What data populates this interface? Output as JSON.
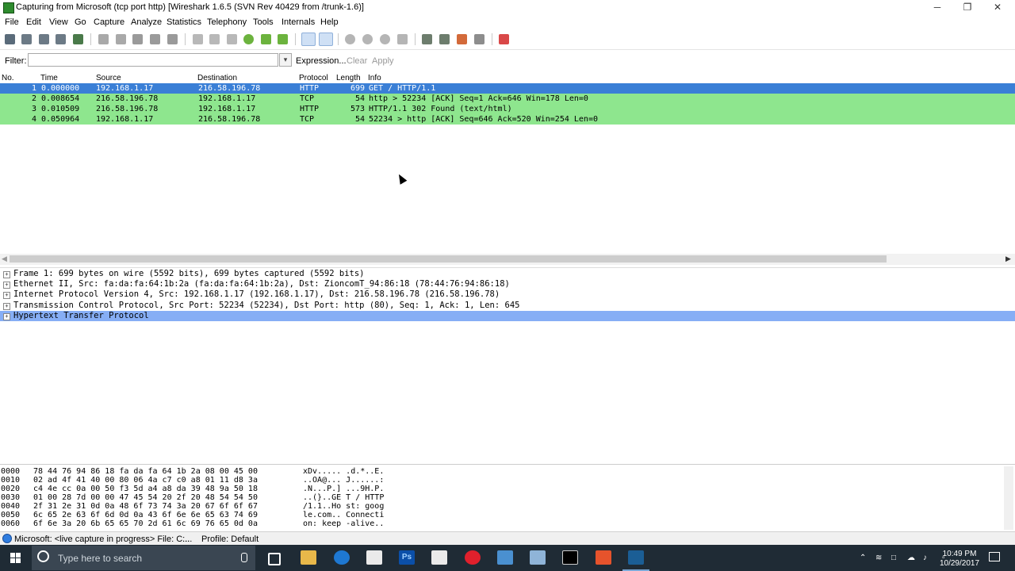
{
  "window": {
    "title": "Capturing from Microsoft (tcp port http)   [Wireshark 1.6.5  (SVN Rev 40429 from /trunk-1.6)]",
    "minimize": "─",
    "maximize": "❐",
    "close": "✕"
  },
  "menu": [
    "File",
    "Edit",
    "View",
    "Go",
    "Capture",
    "Analyze",
    "Statistics",
    "Telephony",
    "Tools",
    "Internals",
    "Help"
  ],
  "filter": {
    "label": "Filter:",
    "value": "",
    "dropdown": "▾",
    "expression": "Expression...",
    "clear": "Clear",
    "apply": "Apply"
  },
  "packet_list": {
    "columns": [
      "No.",
      "Time",
      "Source",
      "Destination",
      "Protocol",
      "Length",
      "Info"
    ],
    "rows": [
      {
        "no": "1",
        "time": "0.000000",
        "source": "192.168.1.17",
        "destination": "216.58.196.78",
        "protocol": "HTTP",
        "length": "699",
        "info": "GET / HTTP/1.1",
        "style": "selected"
      },
      {
        "no": "2",
        "time": "0.008654",
        "source": "216.58.196.78",
        "destination": "192.168.1.17",
        "protocol": "TCP",
        "length": "54",
        "info": "http > 52234 [ACK] Seq=1 Ack=646 Win=178 Len=0",
        "style": "green"
      },
      {
        "no": "3",
        "time": "0.010509",
        "source": "216.58.196.78",
        "destination": "192.168.1.17",
        "protocol": "HTTP",
        "length": "573",
        "info": "HTTP/1.1 302 Found  (text/html)",
        "style": "green"
      },
      {
        "no": "4",
        "time": "0.050964",
        "source": "192.168.1.17",
        "destination": "216.58.196.78",
        "protocol": "TCP",
        "length": "54",
        "info": "52234 > http [ACK] Seq=646 Ack=520 Win=254 Len=0",
        "style": "green"
      }
    ]
  },
  "details": [
    "Frame 1: 699 bytes on wire (5592 bits), 699 bytes captured (5592 bits)",
    "Ethernet II, Src: fa:da:fa:64:1b:2a (fa:da:fa:64:1b:2a), Dst: ZioncomT_94:86:18 (78:44:76:94:86:18)",
    "Internet Protocol Version 4, Src: 192.168.1.17 (192.168.1.17), Dst: 216.58.196.78 (216.58.196.78)",
    "Transmission Control Protocol, Src Port: 52234 (52234), Dst Port: http (80), Seq: 1, Ack: 1, Len: 645",
    "Hypertext Transfer Protocol"
  ],
  "hex": [
    {
      "offset": "0000",
      "bytes": "78 44 76 94 86 18 fa da  fa 64 1b 2a 08 00 45 00",
      "ascii": "xDv.....  .d.*..E."
    },
    {
      "offset": "0010",
      "bytes": "02 ad 4f 41 40 00 80 06  4a c7 c0 a8 01 11 d8 3a",
      "ascii": "..OA@...  J......:"
    },
    {
      "offset": "0020",
      "bytes": "c4 4e cc 0a 00 50 f3 5d  a4 a8 da 39 48 9a 50 18",
      "ascii": ".N...P.]  ...9H.P."
    },
    {
      "offset": "0030",
      "bytes": "01 00 28 7d 00 00 47 45  54 20 2f 20 48 54 54 50",
      "ascii": "..(}..GE T / HTTP"
    },
    {
      "offset": "0040",
      "bytes": "2f 31 2e 31 0d 0a 48 6f  73 74 3a 20 67 6f 6f 67",
      "ascii": "/1.1..Ho st: goog"
    },
    {
      "offset": "0050",
      "bytes": "6c 65 2e 63 6f 6d 0d 0a  43 6f 6e 6e 65 63 74 69",
      "ascii": "le.com.. Connecti"
    },
    {
      "offset": "0060",
      "bytes": "6f 6e 3a 20 6b 65 65 70  2d 61 6c 69 76 65 0d 0a",
      "ascii": "on: keep -alive.."
    }
  ],
  "status": {
    "capture": "Microsoft: <live capture in progress> File: C:...",
    "more": "...",
    "profile": "Profile: Default"
  },
  "taskbar": {
    "search_placeholder": "Type here to search",
    "time": "10:49 PM",
    "date": "10/29/2017",
    "ps_label": "Ps"
  },
  "colors": {
    "selected_row": "#3a7fd6",
    "green_row": "#8ee68e",
    "detail_selected": "#86aef5",
    "taskbar": "#1f2b35"
  }
}
